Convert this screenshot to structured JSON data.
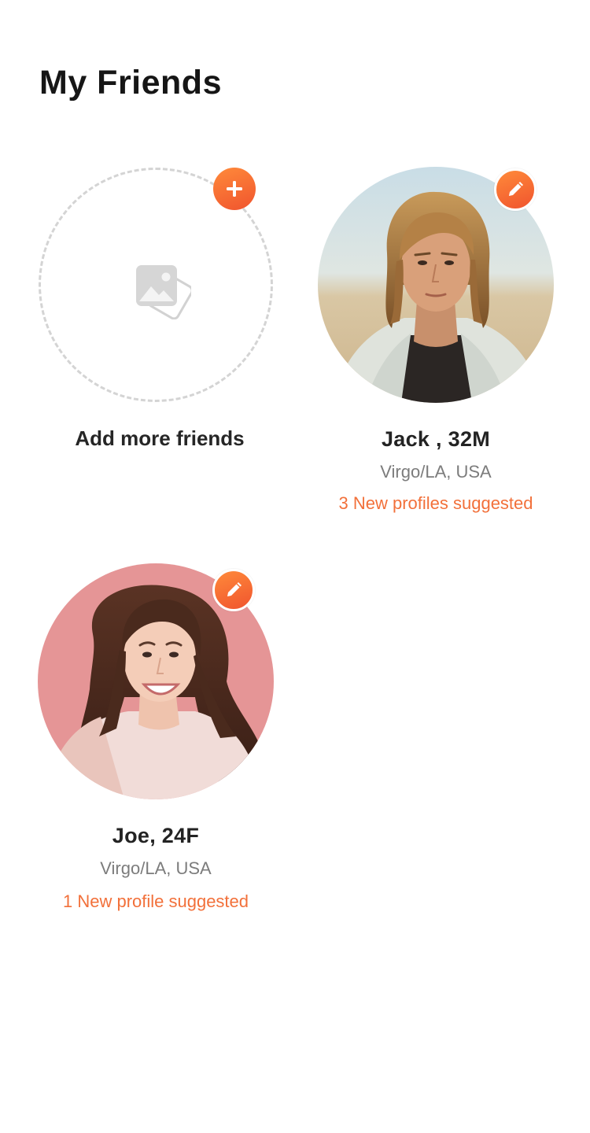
{
  "page": {
    "title": "My Friends"
  },
  "add_friend": {
    "label": "Add more friends",
    "icon": "photo-placeholder-icon",
    "badge_icon": "plus-icon"
  },
  "friends": [
    {
      "name": "Jack , 32M",
      "location": "Virgo/LA, USA",
      "suggestion": "3 New profiles suggested",
      "badge_icon": "pencil-icon"
    },
    {
      "name": "Joe, 24F",
      "location": "Virgo/LA, USA",
      "suggestion": "1 New profile suggested",
      "badge_icon": "pencil-icon"
    }
  ],
  "colors": {
    "accent": "#f2703a",
    "accent_gradient_start": "#ff8a3a",
    "accent_gradient_end": "#f0542e",
    "title": "#161616",
    "muted": "#7c7c7c",
    "dashed_border": "#d4d4d4"
  }
}
